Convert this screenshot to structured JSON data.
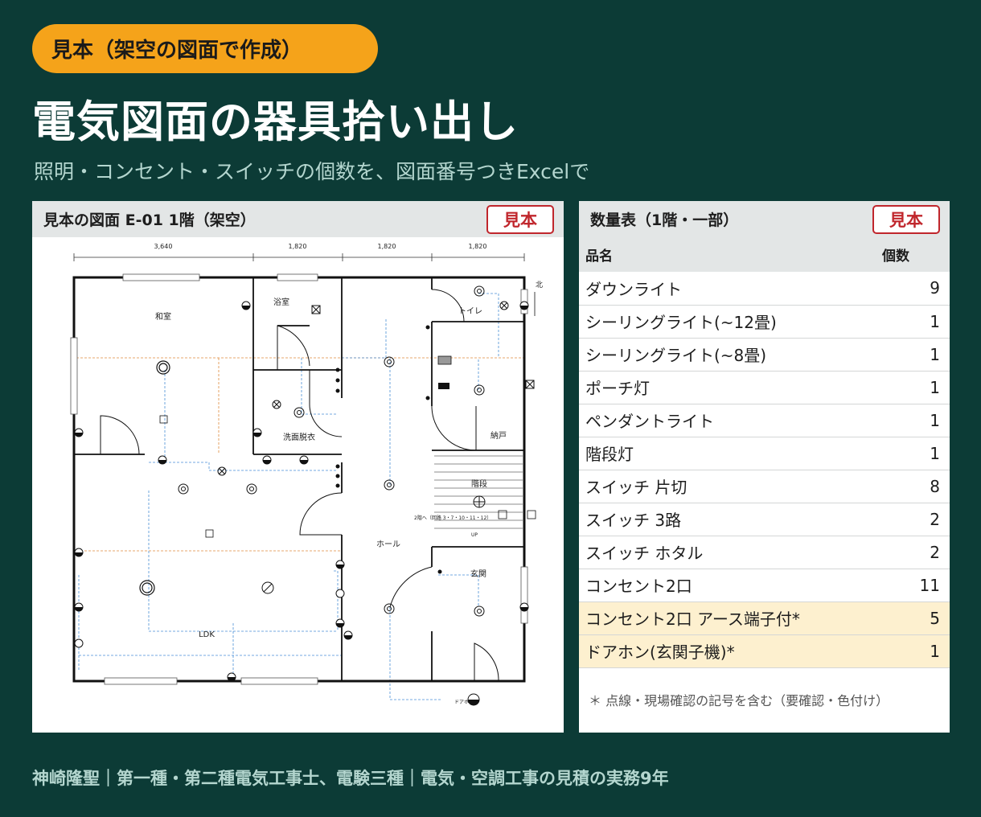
{
  "badge": "見本（架空の図面で作成）",
  "title": "電気図面の器具拾い出し",
  "subtitle": "照明・コンセント・スイッチの個数を、図面番号つきExcelで",
  "drawing_panel": {
    "header": "見本の図面 E-01 1階（架空）",
    "stamp": "見本",
    "dims": [
      "3,640",
      "1,820",
      "1,820",
      "1,820"
    ],
    "rooms": {
      "washitsu": "和室",
      "bath": "浴室",
      "toilet": "トイレ",
      "senmen": "洗面脱衣",
      "nando": "納戸",
      "kaidan": "階段",
      "hall": "ホール",
      "genkan": "玄関",
      "ldk": "LDK"
    },
    "north": "北",
    "up": "UP",
    "stair_note": "2階へ（回路 3・7・10・11・12）",
    "doorphone": "ドアホン"
  },
  "qty_panel": {
    "header": "数量表（1階・一部）",
    "stamp": "見本",
    "col_name": "品名",
    "col_count": "個数",
    "rows": [
      {
        "name": "ダウンライト",
        "count": "9"
      },
      {
        "name": "シーリングライト(~12畳)",
        "count": "1"
      },
      {
        "name": "シーリングライト(~8畳)",
        "count": "1"
      },
      {
        "name": "ポーチ灯",
        "count": "1"
      },
      {
        "name": "ペンダントライト",
        "count": "1"
      },
      {
        "name": "階段灯",
        "count": "1"
      },
      {
        "name": "スイッチ 片切",
        "count": "8"
      },
      {
        "name": "スイッチ 3路",
        "count": "2"
      },
      {
        "name": "スイッチ ホタル",
        "count": "2"
      },
      {
        "name": "コンセント2口",
        "count": "11"
      },
      {
        "name": "コンセント2口 アース端子付*",
        "count": "5"
      },
      {
        "name": "ドアホン(玄関子機)*",
        "count": "1"
      }
    ],
    "note": "＊ 点線・現場確認の記号を含む（要確認・色付け）"
  },
  "footer": "神崎隆聖｜第一種・第二種電気工事士、電験三種｜電気・空調工事の見積の実務9年",
  "colors": {
    "background": "#0c3b36",
    "badge": "#f5a31a",
    "stamp": "#c0262c",
    "highlight": "#fdf0cf",
    "wire": "#4a8fd6",
    "circuit": "#e08a3c"
  }
}
